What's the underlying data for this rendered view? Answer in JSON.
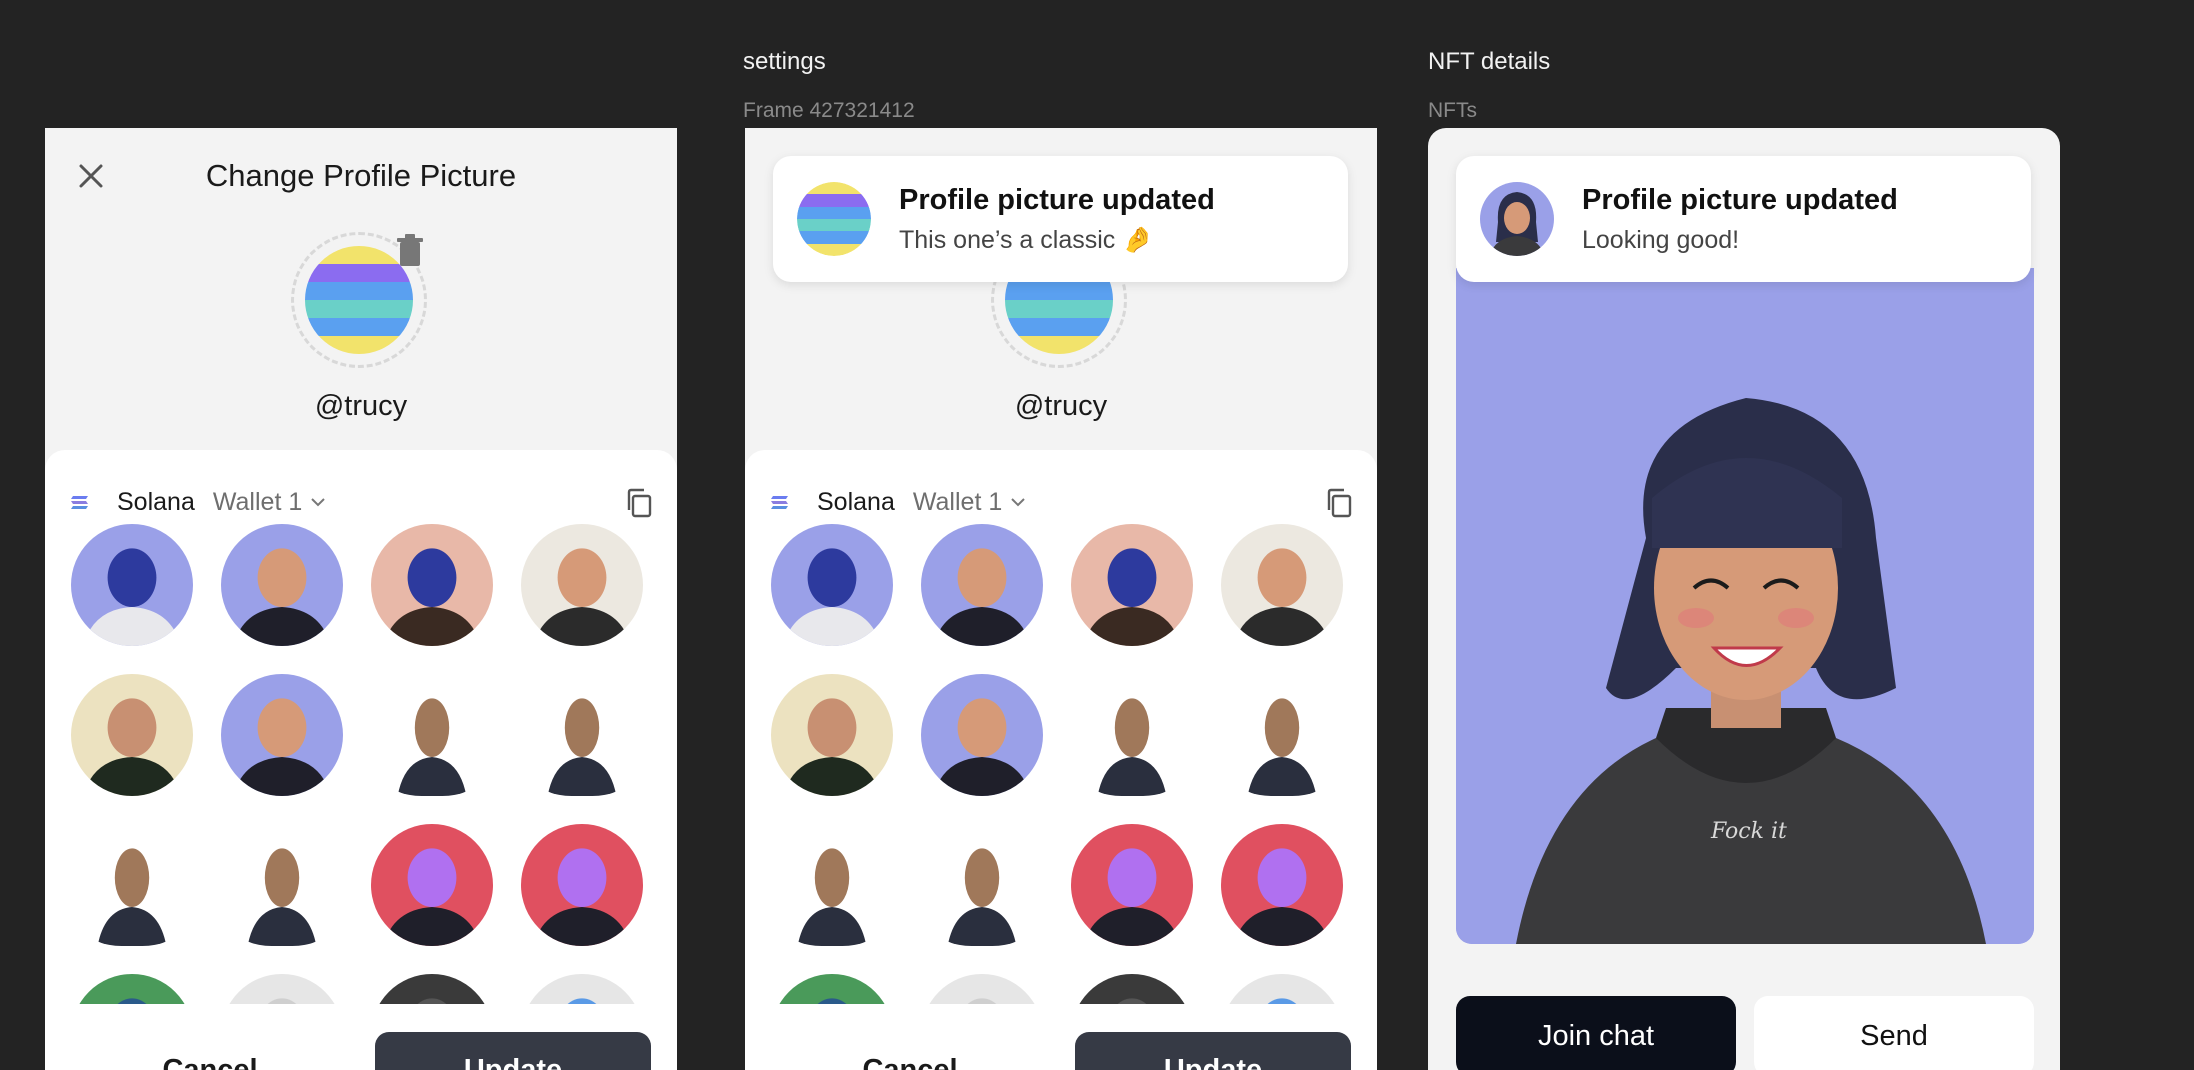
{
  "frames": [
    {
      "label": "",
      "sublabel": ""
    },
    {
      "label": "settings",
      "sublabel": "Frame 427321412"
    },
    {
      "label": "NFT details",
      "sublabel": "NFTs"
    }
  ],
  "modal": {
    "title": "Change Profile Picture",
    "handle": "@trucy",
    "chain": "Solana",
    "wallet": "Wallet 1",
    "cancel_label": "Cancel",
    "update_label": "Update"
  },
  "toast_settings": {
    "title": "Profile picture updated",
    "message": "This one’s a classic 🤌"
  },
  "toast_nft": {
    "title": "Profile picture updated",
    "message": "Looking good!"
  },
  "nft_artwork_text": "Fock it",
  "nft_details": {
    "join_label": "Join chat",
    "send_label": "Send"
  },
  "colors": {
    "background": "#232323",
    "frame": "#f3f3f3",
    "panel": "#ffffff",
    "update_button": "#363a45",
    "join_button": "#0b0f1a",
    "nft_bg": "#9aa0e8"
  },
  "icons": [
    "close-icon",
    "trash-icon",
    "solana-icon",
    "chevron-down-icon",
    "copy-icon"
  ]
}
